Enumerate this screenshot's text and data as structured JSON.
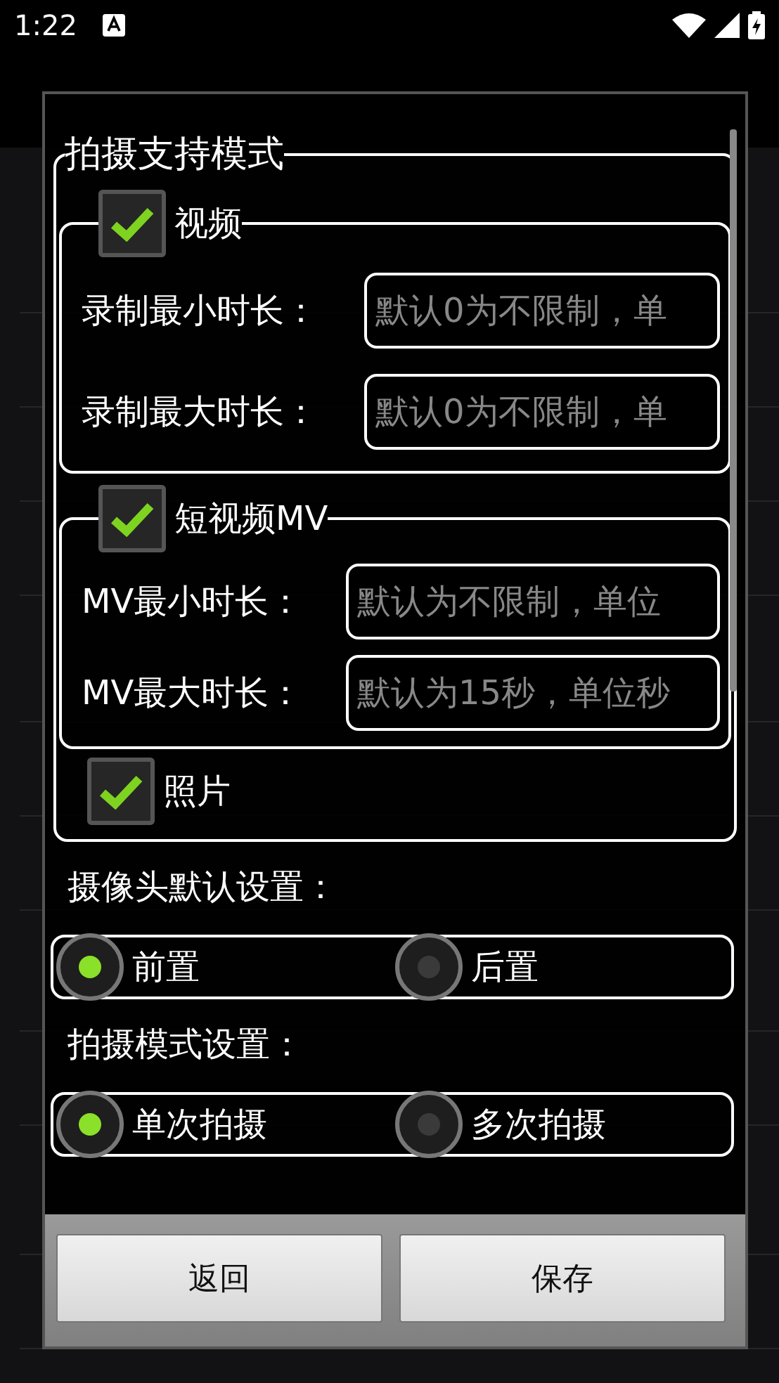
{
  "status_bar": {
    "time": "1:22"
  },
  "dialog": {
    "group_title": "拍摄支持模式",
    "modes": [
      {
        "label": "视频",
        "checked": true,
        "fields": [
          {
            "label": "录制最小时长：",
            "placeholder": "默认0为不限制，单"
          },
          {
            "label": "录制最大时长：",
            "placeholder": "默认0为不限制，单"
          }
        ]
      },
      {
        "label": "短视频MV",
        "checked": true,
        "fields": [
          {
            "label": "MV最小时长：",
            "placeholder": "默认为不限制，单位"
          },
          {
            "label": "MV最大时长：",
            "placeholder": "默认为15秒，单位秒"
          }
        ]
      },
      {
        "label": "照片",
        "checked": true
      }
    ],
    "settings": [
      {
        "title": "摄像头默认设置：",
        "options": [
          {
            "label": "前置",
            "selected": true
          },
          {
            "label": "后置",
            "selected": false
          }
        ]
      },
      {
        "title": "拍摄模式设置：",
        "options": [
          {
            "label": "单次拍摄",
            "selected": true
          },
          {
            "label": "多次拍摄",
            "selected": false
          }
        ]
      }
    ],
    "buttons": [
      "返回",
      "保存"
    ]
  }
}
